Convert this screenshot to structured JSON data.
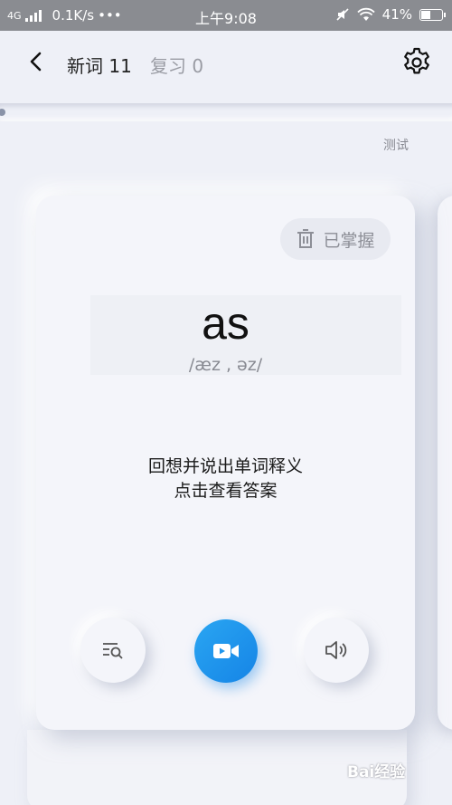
{
  "status_bar": {
    "network": "4G",
    "speed": "0.1K/s",
    "more": "•••",
    "time": "上午9:08",
    "battery": "41%",
    "battery_level": 0.41
  },
  "header": {
    "new_words": "新词 11",
    "review": "复习 0",
    "back_icon": "chevron-left-icon",
    "settings_icon": "gear-icon"
  },
  "test_link": "测试",
  "card": {
    "mastered_label": "已掌握",
    "word": "as",
    "phonetic": "/æz , əz/",
    "prompt_line1": "回想并说出单词释义",
    "prompt_line2": "点击查看答案"
  },
  "actions": {
    "lookup_icon": "list-search-icon",
    "video_icon": "video-camera-icon",
    "audio_icon": "speaker-icon"
  },
  "watermark": "Bai经验",
  "colors": {
    "accent": "#1E95EC",
    "background": "#EEF0F7",
    "status_bar": "#8A8C91"
  }
}
